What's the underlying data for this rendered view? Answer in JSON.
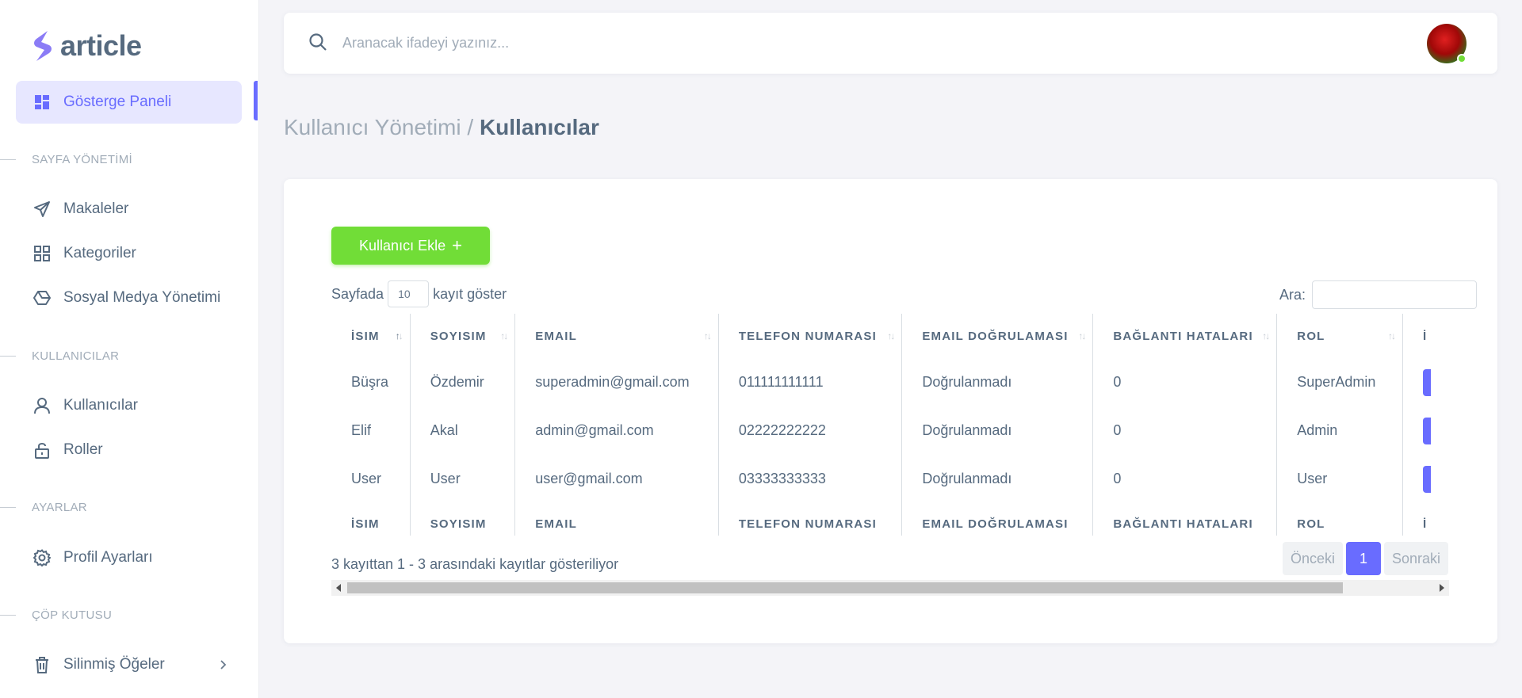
{
  "brand": {
    "name": "article"
  },
  "sidebar": {
    "dashboard": {
      "label": "Gösterge Paneli",
      "icon": "dashboard-icon"
    },
    "sections": [
      {
        "header": "SAYFA YÖNETİMİ"
      },
      {
        "header": "KULLANICILAR"
      },
      {
        "header": "AYARLAR"
      },
      {
        "header": "ÇÖP KUTUSU"
      }
    ],
    "items": [
      {
        "label": "Makaleler",
        "icon": "send-icon"
      },
      {
        "label": "Kategoriler",
        "icon": "grid-icon"
      },
      {
        "label": "Sosyal Medya Yönetimi",
        "icon": "cube-icon"
      },
      {
        "label": "Kullanıcılar",
        "icon": "user-icon"
      },
      {
        "label": "Roller",
        "icon": "lock-open-icon"
      },
      {
        "label": "Profil Ayarları",
        "icon": "gear-icon"
      },
      {
        "label": "Silinmiş Öğeler",
        "icon": "trash-icon"
      }
    ]
  },
  "navbar": {
    "search_placeholder": "Aranacak ifadeyi yazınız..."
  },
  "breadcrumb": {
    "parent": "Kullanıcı Yönetimi /",
    "current": "Kullanıcılar"
  },
  "toolbar": {
    "add_label": "Kullanıcı Ekle",
    "add_icon": "+"
  },
  "length": {
    "prefix": "Sayfada",
    "value": "10",
    "suffix": "kayıt göster"
  },
  "filter": {
    "label": "Ara:"
  },
  "table": {
    "headers": [
      "İSIM",
      "SOYISIM",
      "EMAIL",
      "TELEFON NUMARASI",
      "EMAIL DOĞRULAMASI",
      "BAĞLANTI HATALARI",
      "ROL",
      "İ"
    ],
    "rows": [
      [
        "Büşra",
        "Özdemir",
        "superadmin@gmail.com",
        "011111111111",
        "Doğrulanmadı",
        "0",
        "SuperAdmin"
      ],
      [
        "Elif",
        "Akal",
        "admin@gmail.com",
        "02222222222",
        "Doğrulanmadı",
        "0",
        "Admin"
      ],
      [
        "User",
        "User",
        "user@gmail.com",
        "03333333333",
        "Doğrulanmadı",
        "0",
        "User"
      ]
    ]
  },
  "info": "3 kayıttan 1 - 3 arasındaki kayıtlar gösteriliyor",
  "pagination": {
    "prev": "Önceki",
    "current": "1",
    "next": "Sonraki"
  },
  "colors": {
    "primary": "#696cff",
    "success": "#71dd37",
    "text": "#566a7f",
    "muted": "#a1acb8"
  }
}
